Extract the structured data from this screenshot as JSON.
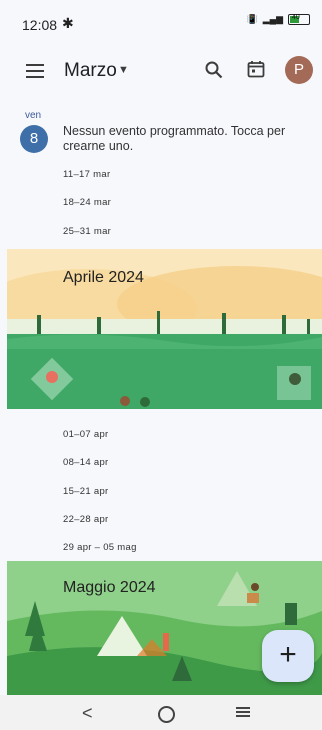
{
  "status_bar": {
    "time": "12:08",
    "battery": "40"
  },
  "app_bar": {
    "title": "Marzo"
  },
  "day_entry": {
    "day_label": "ven",
    "day_number": "8",
    "message": "Nessun evento programmato. Tocca per crearne uno."
  },
  "weeks_march": [
    "11–17 mar",
    "18–24 mar",
    "25–31 mar"
  ],
  "april_banner": {
    "title": "Aprile 2024"
  },
  "weeks_april": [
    "01–07 apr",
    "08–14 apr",
    "15–21 apr",
    "22–28 apr",
    "29 apr – 05 mag"
  ],
  "may_banner": {
    "title": "Maggio 2024"
  },
  "fab": {
    "label": "+"
  },
  "colors": {
    "accent": "#3f6fa8",
    "avatar": "#a26a57",
    "fab": "#dbe6fb"
  }
}
